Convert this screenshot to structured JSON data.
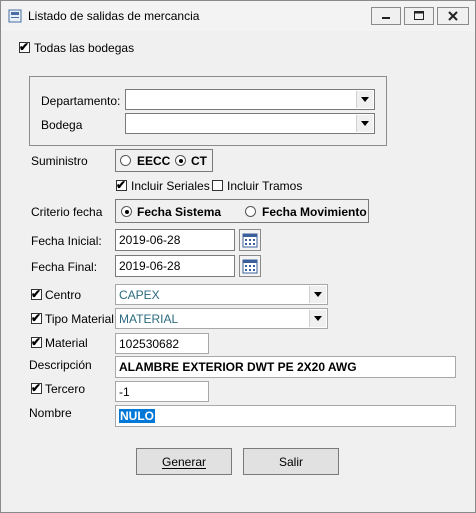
{
  "window": {
    "title": "Listado de salidas de mercancia",
    "controls": {
      "minimize": "minimize-icon",
      "maximize": "maximize-icon",
      "close": "close-icon"
    }
  },
  "todas_bodegas": {
    "label": "Todas las bodegas",
    "checked": true
  },
  "departamento": {
    "label": "Departamento:",
    "value": ""
  },
  "bodega": {
    "label": "Bodega",
    "value": ""
  },
  "suministro": {
    "label": "Suministro",
    "options": [
      {
        "label": "EECC",
        "selected": false
      },
      {
        "label": "CT",
        "selected": true
      }
    ]
  },
  "incluir_seriales": {
    "label": "Incluir Seriales",
    "checked": true
  },
  "incluir_tramos": {
    "label": "Incluir Tramos",
    "checked": false
  },
  "criterio_fecha": {
    "label": "Criterio fecha",
    "options": [
      {
        "label": "Fecha Sistema",
        "selected": true
      },
      {
        "label": "Fecha Movimiento",
        "selected": false
      }
    ]
  },
  "fecha_inicial": {
    "label": "Fecha Inicial:",
    "value": "2019-06-28"
  },
  "fecha_final": {
    "label": "Fecha Final:",
    "value": "2019-06-28"
  },
  "centro": {
    "label": "Centro",
    "checked": true,
    "value": "CAPEX"
  },
  "tipo_material": {
    "label": "Tipo Material",
    "checked": true,
    "value": "MATERIAL"
  },
  "material": {
    "label": "Material",
    "checked": true,
    "value": "102530682"
  },
  "descripcion": {
    "label": "Descripción",
    "value": "ALAMBRE EXTERIOR DWT PE 2X20 AWG"
  },
  "tercero": {
    "label": "Tercero",
    "checked": true,
    "value": "-1"
  },
  "nombre": {
    "label": "Nombre",
    "value": "NULO"
  },
  "buttons": {
    "generar": "Generar",
    "salir": "Salir"
  },
  "colors": {
    "disabled_text": "#2d6b80",
    "selection": "#0078d7",
    "title_text": "#000000"
  }
}
